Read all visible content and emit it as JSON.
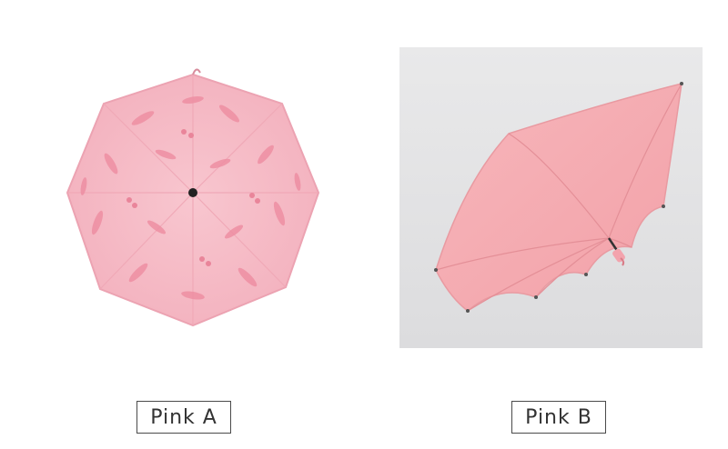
{
  "products": [
    {
      "label": "Pink A",
      "color": "#f6b9c4",
      "pattern": "feather-print"
    },
    {
      "label": "Pink B",
      "color": "#f5a8ae",
      "pattern": "solid"
    }
  ],
  "colors": {
    "background": "#ffffff",
    "label_border": "#4a4a4a",
    "label_text": "#333333"
  }
}
